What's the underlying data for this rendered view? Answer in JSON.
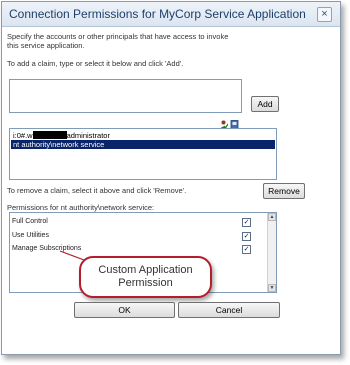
{
  "dialog": {
    "title": "Connection Permissions for MyCorp Service Application",
    "close_glyph": "×",
    "intro_line1": "Specify the accounts or other principals that have access to invoke",
    "intro_line2": "this service application.",
    "add_hint": "To add a claim, type or select it below and click 'Add'.",
    "add_label": "Add",
    "claims": [
      {
        "prefix": "i:0#.w",
        "suffix": "administrator",
        "redacted": true,
        "selected": false
      },
      {
        "text": "nt authority\\network service",
        "selected": true
      }
    ],
    "remove_hint": "To remove a claim, select it above and click 'Remove'.",
    "remove_label": "Remove",
    "permissions_heading": "Permissions for nt authority\\network service:",
    "permissions": [
      {
        "label": "Full Control",
        "checked": true
      },
      {
        "label": "Use Utilities",
        "checked": true
      },
      {
        "label": "Manage Subscriptions",
        "checked": true
      }
    ],
    "ok_label": "OK",
    "cancel_label": "Cancel",
    "check_glyph": "✓"
  },
  "callout": {
    "line1": "Custom Application",
    "line2": "Permission",
    "border_color": "#b21e2b"
  },
  "icons": [
    "check-names-icon",
    "browse-address-book-icon"
  ]
}
